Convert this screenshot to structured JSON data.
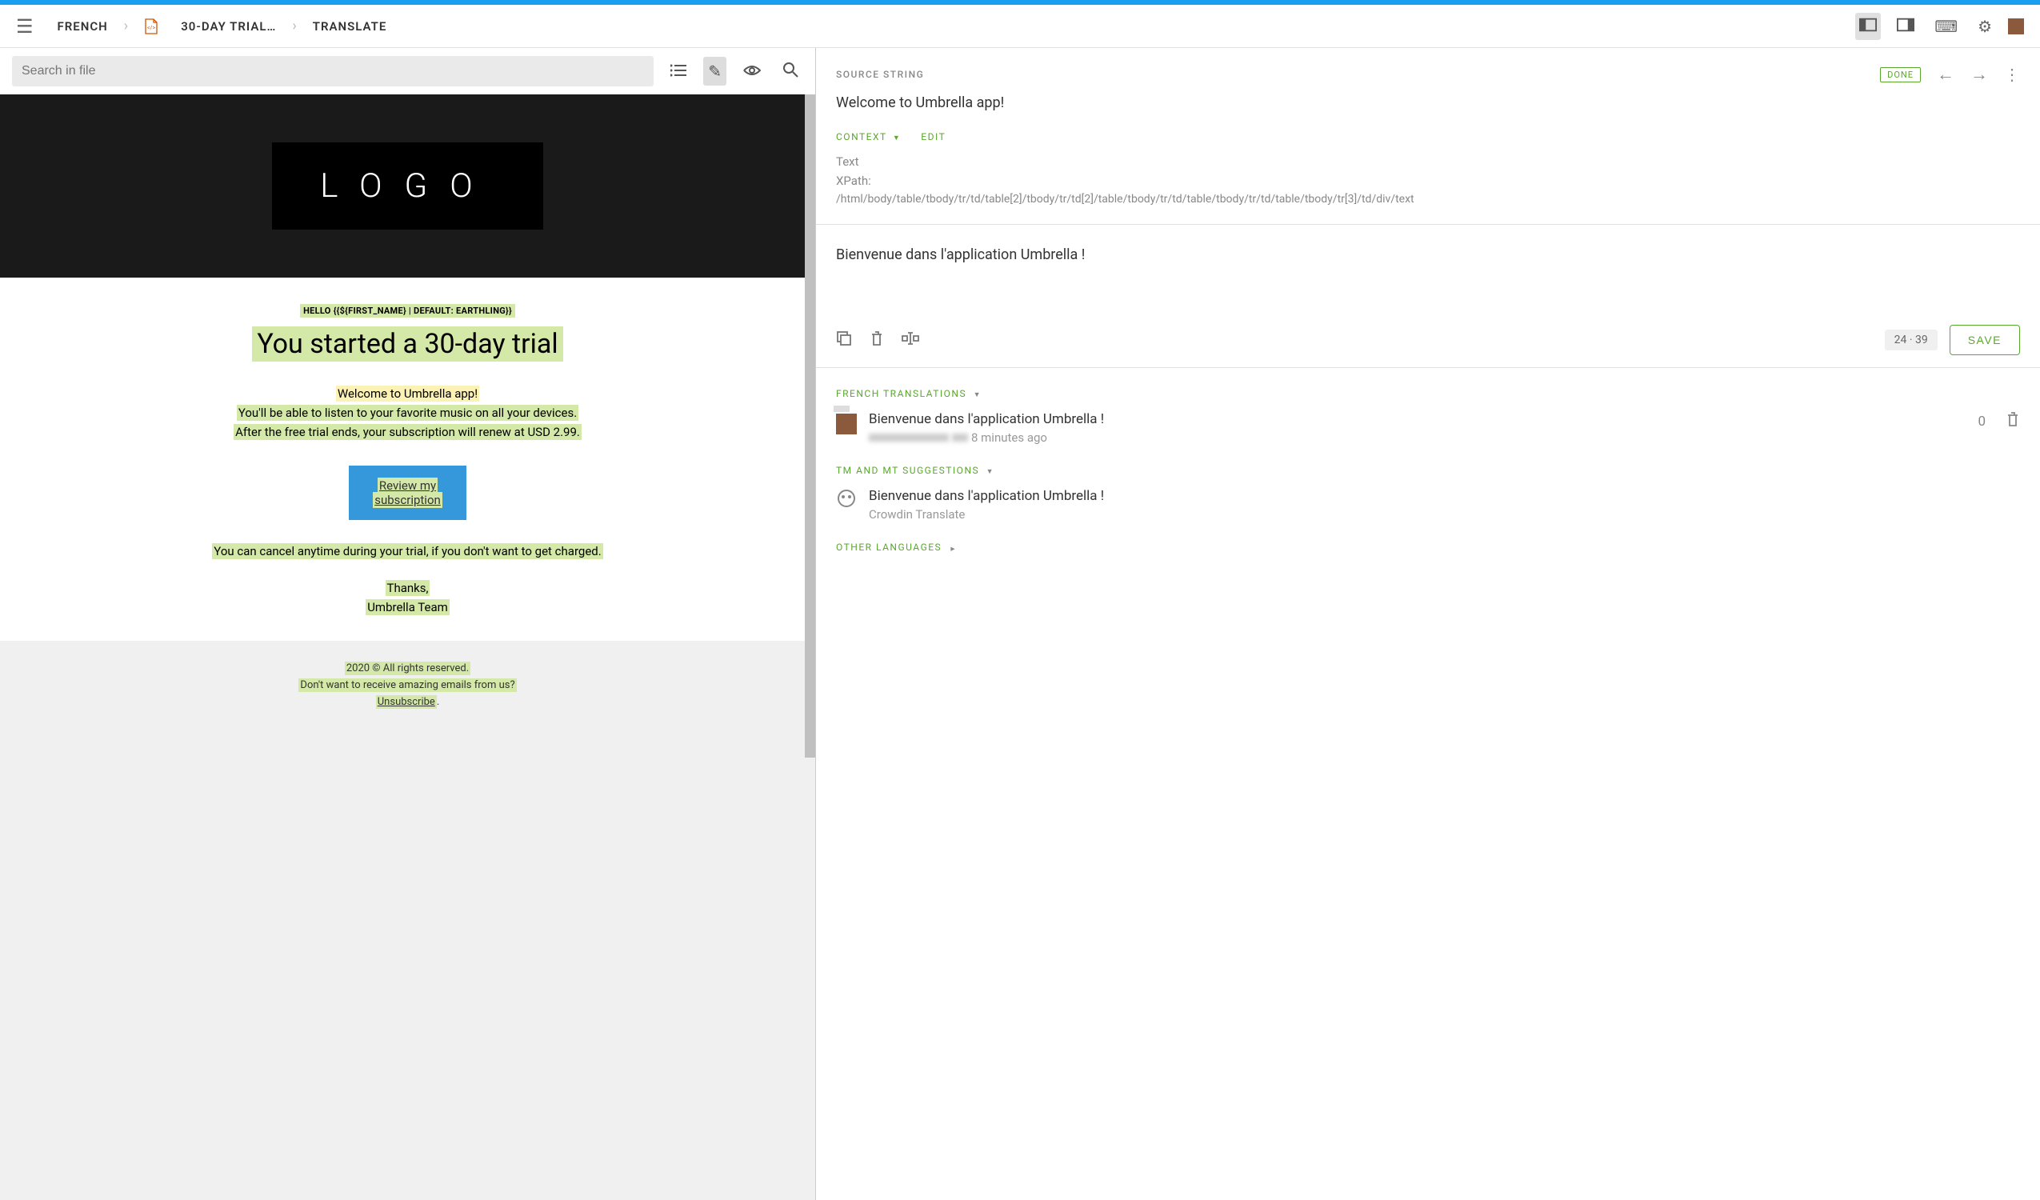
{
  "header": {
    "breadcrumb": {
      "lang": "FRENCH",
      "file": "30-DAY TRIAL…",
      "action": "TRANSLATE"
    }
  },
  "toolbar": {
    "search_placeholder": "Search in file"
  },
  "preview": {
    "logo": "LOGO",
    "hello": "HELLO {{${FIRST_NAME} | DEFAULT: EARTHLING}}",
    "headline": "You started a 30-day trial",
    "welcome": "Welcome to Umbrella app!",
    "line2": "You'll be able to listen to your favorite music on all your devices.",
    "line3": "After the free trial ends, your subscription will renew at USD 2.99.",
    "cta_line1": "Review my",
    "cta_line2": "subscription",
    "cancel": "You can cancel anytime during your trial, if you don't want to get charged.",
    "thanks": "Thanks,",
    "team": "Umbrella Team",
    "footer1": "2020 © All rights reserved.",
    "footer2": "Don't want to receive amazing emails from us?",
    "footer3": "Unsubscribe"
  },
  "source": {
    "label": "SOURCE STRING",
    "text": "Welcome to Umbrella app!",
    "done": "DONE",
    "context_label": "CONTEXT",
    "edit_label": "EDIT",
    "meta_text": "Text",
    "meta_xpath_label": "XPath:",
    "meta_xpath": "/html/body/table/tbody/tr/td/table[2]/tbody/tr/td[2]/table/tbody/tr/td/table/tbody/tr/td/table/tbody/tr[3]/td/div/text"
  },
  "translation": {
    "input_value": "Bienvenue dans l'application Umbrella !",
    "char_count": "24 · 39",
    "save_label": "SAVE"
  },
  "sections": {
    "french": "FRENCH TRANSLATIONS",
    "tm": "TM AND MT SUGGESTIONS",
    "other": "OTHER LANGUAGES"
  },
  "french_entry": {
    "text": "Bienvenue dans l'application Umbrella !",
    "time": "8 minutes ago",
    "vote": "0"
  },
  "tm_entry": {
    "text": "Bienvenue dans l'application Umbrella !",
    "source": "Crowdin Translate"
  }
}
